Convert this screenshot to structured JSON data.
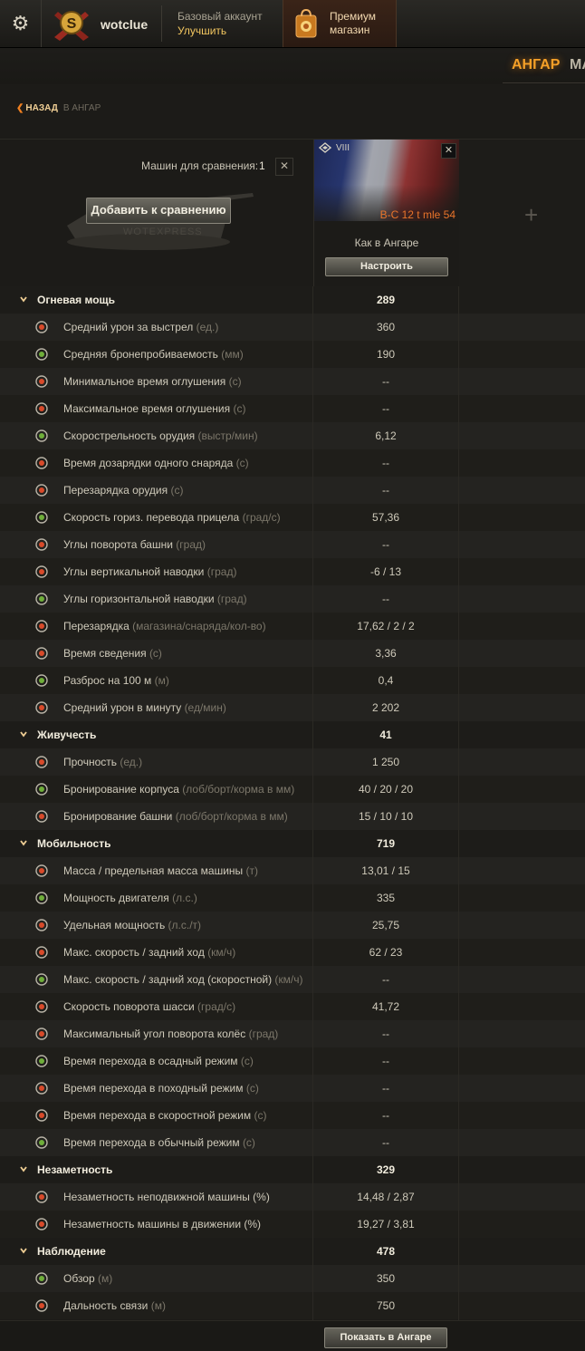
{
  "header": {
    "username": "wotclue",
    "account_type": "Базовый аккаунт",
    "upgrade_label": "Улучшить",
    "premium_line1": "Премиум",
    "premium_line2": "магазин"
  },
  "nav": {
    "active_tab": "АНГАР",
    "next_tab": "МА"
  },
  "breadcrumb": {
    "back_label": "НАЗАД",
    "destination": "В АНГАР"
  },
  "compare": {
    "count_label": "Машин для сравнения:",
    "count_value": "1",
    "clear_glyph": "✕",
    "add_button": "Добавить к сравнению",
    "watermark": "WOTEXPRESS",
    "vehicle": {
      "tier": "VIII",
      "name": "B-C 12 t mle 54",
      "config": "Как в Ангаре",
      "configure_button": "Настроить",
      "close_glyph": "✕"
    },
    "add_slot_glyph": "+"
  },
  "sections": [
    {
      "title": "Огневая мощь",
      "value": "289",
      "rows": [
        {
          "name": "Средний урон за выстрел",
          "unit": "(ед.)",
          "value": "360",
          "icon": "damage-icon"
        },
        {
          "name": "Средняя бронепробиваемость",
          "unit": "(мм)",
          "value": "190",
          "icon": "penetration-icon"
        },
        {
          "name": "Минимальное время оглушения",
          "unit": "(с)",
          "value": "--",
          "icon": "stun-min-icon"
        },
        {
          "name": "Максимальное время оглушения",
          "unit": "(с)",
          "value": "--",
          "icon": "stun-max-icon"
        },
        {
          "name": "Скорострельность орудия",
          "unit": "(выстр/мин)",
          "value": "6,12",
          "icon": "rate-of-fire-icon"
        },
        {
          "name": "Время дозарядки одного снаряда",
          "unit": "(с)",
          "value": "--",
          "icon": "shell-reload-icon"
        },
        {
          "name": "Перезарядка орудия",
          "unit": "(с)",
          "value": "--",
          "icon": "gun-reload-icon"
        },
        {
          "name": "Скорость гориз. перевода прицела",
          "unit": "(град/с)",
          "value": "57,36",
          "icon": "traverse-speed-icon"
        },
        {
          "name": "Углы поворота башни",
          "unit": "(град)",
          "value": "--",
          "icon": "turret-angles-icon"
        },
        {
          "name": "Углы вертикальной наводки",
          "unit": "(град)",
          "value": "-6 / 13",
          "icon": "elevation-icon"
        },
        {
          "name": "Углы горизонтальной наводки",
          "unit": "(град)",
          "value": "--",
          "icon": "horizontal-aim-icon"
        },
        {
          "name": "Перезарядка",
          "unit": "(магазина/снаряда/кол-во)",
          "value": "17,62 / 2 / 2",
          "icon": "magazine-icon"
        },
        {
          "name": "Время сведения",
          "unit": "(с)",
          "value": "3,36",
          "icon": "aim-time-icon"
        },
        {
          "name": "Разброс на 100 м",
          "unit": "(м)",
          "value": "0,4",
          "icon": "dispersion-icon"
        },
        {
          "name": "Средний урон в минуту",
          "unit": "(ед/мин)",
          "value": "2 202",
          "icon": "dpm-icon"
        }
      ]
    },
    {
      "title": "Живучесть",
      "value": "41",
      "rows": [
        {
          "name": "Прочность",
          "unit": "(ед.)",
          "value": "1 250",
          "icon": "hitpoints-icon"
        },
        {
          "name": "Бронирование корпуса",
          "unit": "(лоб/борт/корма в мм)",
          "value": "40 / 20 / 20",
          "icon": "hull-armor-icon"
        },
        {
          "name": "Бронирование башни",
          "unit": "(лоб/борт/корма в мм)",
          "value": "15 / 10 / 10",
          "icon": "turret-armor-icon"
        }
      ]
    },
    {
      "title": "Мобильность",
      "value": "719",
      "rows": [
        {
          "name": "Масса / предельная масса машины",
          "unit": "(т)",
          "value": "13,01 / 15",
          "icon": "weight-icon"
        },
        {
          "name": "Мощность двигателя",
          "unit": "(л.с.)",
          "value": "335",
          "icon": "engine-power-icon"
        },
        {
          "name": "Удельная мощность",
          "unit": "(л.с./т)",
          "value": "25,75",
          "icon": "specific-power-icon"
        },
        {
          "name": "Макс. скорость / задний ход",
          "unit": "(км/ч)",
          "value": "62 / 23",
          "icon": "speed-icon"
        },
        {
          "name": "Макс. скорость / задний ход (скоростной)",
          "unit": "(км/ч)",
          "value": "--",
          "icon": "speed-mode-icon"
        },
        {
          "name": "Скорость поворота шасси",
          "unit": "(град/с)",
          "value": "41,72",
          "icon": "hull-traverse-icon"
        },
        {
          "name": "Максимальный угол поворота колёс",
          "unit": "(град)",
          "value": "--",
          "icon": "wheel-angle-icon"
        },
        {
          "name": "Время перехода в осадный режим ",
          "unit": "(с)",
          "value": "--",
          "icon": "siege-mode-icon"
        },
        {
          "name": "Время перехода в походный режим ",
          "unit": "(с)",
          "value": "--",
          "icon": "travel-mode-icon"
        },
        {
          "name": "Время перехода в скоростной режим",
          "unit": "(с)",
          "value": "--",
          "icon": "fast-mode-icon"
        },
        {
          "name": "Время перехода в обычный режим",
          "unit": "(с)",
          "value": "--",
          "icon": "normal-mode-icon"
        }
      ]
    },
    {
      "title": "Незаметность",
      "value": "329",
      "rows": [
        {
          "name": "Незаметность неподвижной машины (%)",
          "unit": "",
          "value": "14,48 / 2,87",
          "icon": "camo-stationary-icon"
        },
        {
          "name": "Незаметность машины в движении (%)",
          "unit": "",
          "value": "19,27 / 3,81",
          "icon": "camo-moving-icon"
        }
      ]
    },
    {
      "title": "Наблюдение",
      "value": "478",
      "rows": [
        {
          "name": "Обзор",
          "unit": "(м)",
          "value": "350",
          "icon": "view-range-icon"
        },
        {
          "name": "Дальность связи",
          "unit": "(м)",
          "value": "750",
          "icon": "radio-range-icon"
        }
      ]
    }
  ],
  "footer": {
    "show_in_hangar": "Показать в Ангаре"
  },
  "colors": {
    "accent_orange": "#f5a028",
    "vehicle_name": "#e8742a",
    "icon_red": "#d84a2a",
    "icon_green": "#6fae3a"
  }
}
